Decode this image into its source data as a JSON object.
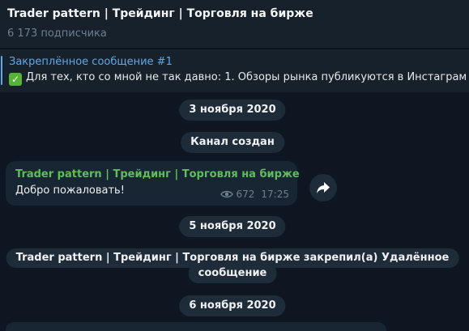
{
  "header": {
    "title": "Trader pattern | Трейдинг | Торговля на бирже",
    "subscribers": "6 173 подписчика"
  },
  "pinned": {
    "title": "Закреплённое сообщение #1",
    "check_icon": "check-mark-icon",
    "text": "Для тех, кто со мной не так давно:  1. Обзоры рынка публикуются в Инстаграм"
  },
  "feed": {
    "date1": "3 ноября 2020",
    "channel_created": "Канал создан",
    "message": {
      "author": "Trader pattern | Трейдинг | Торговля на бирже",
      "text": "Добро пожаловать!",
      "views": "672",
      "time": "17:25",
      "views_icon": "eye-icon",
      "forward_icon": "forward-arrow-icon"
    },
    "date2": "5 ноября 2020",
    "pin_service_line1": "Trader pattern | Трейдинг | Торговля на бирже закрепил(а) Удалённое",
    "pin_service_line2": "сообщение",
    "date3": "6 ноября 2020"
  },
  "colors": {
    "background": "#0e1621",
    "panel": "#17212b",
    "bubble": "#182533",
    "chip": "#1e2c3a",
    "accent_blue": "#5fa8e8",
    "author_green": "#5fbe5a",
    "muted": "#6d7f8f"
  }
}
